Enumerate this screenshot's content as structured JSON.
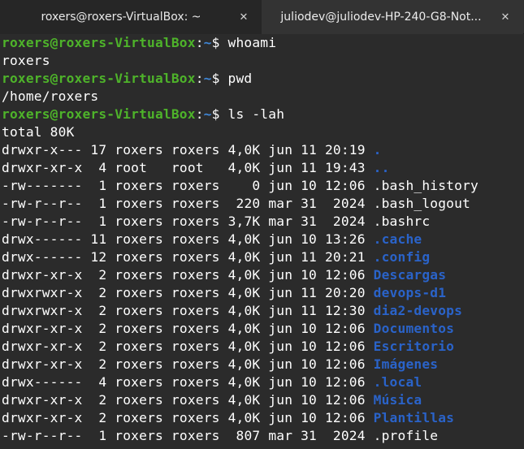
{
  "tabs": [
    {
      "title": "roxers@roxers-VirtualBox: ~",
      "close": "✕",
      "active": true
    },
    {
      "title": "juliodev@juliodev-HP-240-G8-Not...",
      "close": "✕",
      "active": false
    }
  ],
  "prompt": {
    "user": "roxers@roxers-VirtualBox",
    "sep": ":",
    "path": "~",
    "symbol": "$ "
  },
  "session": [
    {
      "cmd": "whoami",
      "out": [
        "roxers"
      ]
    },
    {
      "cmd": "pwd",
      "out": [
        "/home/roxers"
      ]
    },
    {
      "cmd": "ls -lah",
      "out": [
        "total 80K"
      ]
    }
  ],
  "listing": [
    {
      "perm": "drwxr-x---",
      "links": "17",
      "owner": "roxers",
      "group": "roxers",
      "size": "4,0K",
      "month": "jun",
      "day": "11",
      "time": "20:19",
      "name": ".",
      "dir": true
    },
    {
      "perm": "drwxr-xr-x",
      "links": " 4",
      "owner": "root  ",
      "group": "root  ",
      "size": "4,0K",
      "month": "jun",
      "day": "11",
      "time": "19:43",
      "name": "..",
      "dir": true
    },
    {
      "perm": "-rw-------",
      "links": " 1",
      "owner": "roxers",
      "group": "roxers",
      "size": "   0",
      "month": "jun",
      "day": "10",
      "time": "12:06",
      "name": ".bash_history",
      "dir": false
    },
    {
      "perm": "-rw-r--r--",
      "links": " 1",
      "owner": "roxers",
      "group": "roxers",
      "size": " 220",
      "month": "mar",
      "day": "31",
      "time": " 2024",
      "name": ".bash_logout",
      "dir": false
    },
    {
      "perm": "-rw-r--r--",
      "links": " 1",
      "owner": "roxers",
      "group": "roxers",
      "size": "3,7K",
      "month": "mar",
      "day": "31",
      "time": " 2024",
      "name": ".bashrc",
      "dir": false
    },
    {
      "perm": "drwx------",
      "links": "11",
      "owner": "roxers",
      "group": "roxers",
      "size": "4,0K",
      "month": "jun",
      "day": "10",
      "time": "13:26",
      "name": ".cache",
      "dir": true
    },
    {
      "perm": "drwx------",
      "links": "12",
      "owner": "roxers",
      "group": "roxers",
      "size": "4,0K",
      "month": "jun",
      "day": "11",
      "time": "20:21",
      "name": ".config",
      "dir": true
    },
    {
      "perm": "drwxr-xr-x",
      "links": " 2",
      "owner": "roxers",
      "group": "roxers",
      "size": "4,0K",
      "month": "jun",
      "day": "10",
      "time": "12:06",
      "name": "Descargas",
      "dir": true
    },
    {
      "perm": "drwxrwxr-x",
      "links": " 2",
      "owner": "roxers",
      "group": "roxers",
      "size": "4,0K",
      "month": "jun",
      "day": "11",
      "time": "20:20",
      "name": "devops-d1",
      "dir": true
    },
    {
      "perm": "drwxrwxr-x",
      "links": " 2",
      "owner": "roxers",
      "group": "roxers",
      "size": "4,0K",
      "month": "jun",
      "day": "11",
      "time": "12:30",
      "name": "dia2-devops",
      "dir": true
    },
    {
      "perm": "drwxr-xr-x",
      "links": " 2",
      "owner": "roxers",
      "group": "roxers",
      "size": "4,0K",
      "month": "jun",
      "day": "10",
      "time": "12:06",
      "name": "Documentos",
      "dir": true
    },
    {
      "perm": "drwxr-xr-x",
      "links": " 2",
      "owner": "roxers",
      "group": "roxers",
      "size": "4,0K",
      "month": "jun",
      "day": "10",
      "time": "12:06",
      "name": "Escritorio",
      "dir": true
    },
    {
      "perm": "drwxr-xr-x",
      "links": " 2",
      "owner": "roxers",
      "group": "roxers",
      "size": "4,0K",
      "month": "jun",
      "day": "10",
      "time": "12:06",
      "name": "Imágenes",
      "dir": true
    },
    {
      "perm": "drwx------",
      "links": " 4",
      "owner": "roxers",
      "group": "roxers",
      "size": "4,0K",
      "month": "jun",
      "day": "10",
      "time": "12:06",
      "name": ".local",
      "dir": true
    },
    {
      "perm": "drwxr-xr-x",
      "links": " 2",
      "owner": "roxers",
      "group": "roxers",
      "size": "4,0K",
      "month": "jun",
      "day": "10",
      "time": "12:06",
      "name": "Música",
      "dir": true
    },
    {
      "perm": "drwxr-xr-x",
      "links": " 2",
      "owner": "roxers",
      "group": "roxers",
      "size": "4,0K",
      "month": "jun",
      "day": "10",
      "time": "12:06",
      "name": "Plantillas",
      "dir": true
    },
    {
      "perm": "-rw-r--r--",
      "links": " 1",
      "owner": "roxers",
      "group": "roxers",
      "size": " 807",
      "month": "mar",
      "day": "31",
      "time": " 2024",
      "name": ".profile",
      "dir": false
    }
  ],
  "colors": {
    "user": "#4eb32a",
    "path": "#3f86d6",
    "dir": "#2a63c9",
    "text": "#ffffff",
    "background": "#2b2b2b"
  }
}
